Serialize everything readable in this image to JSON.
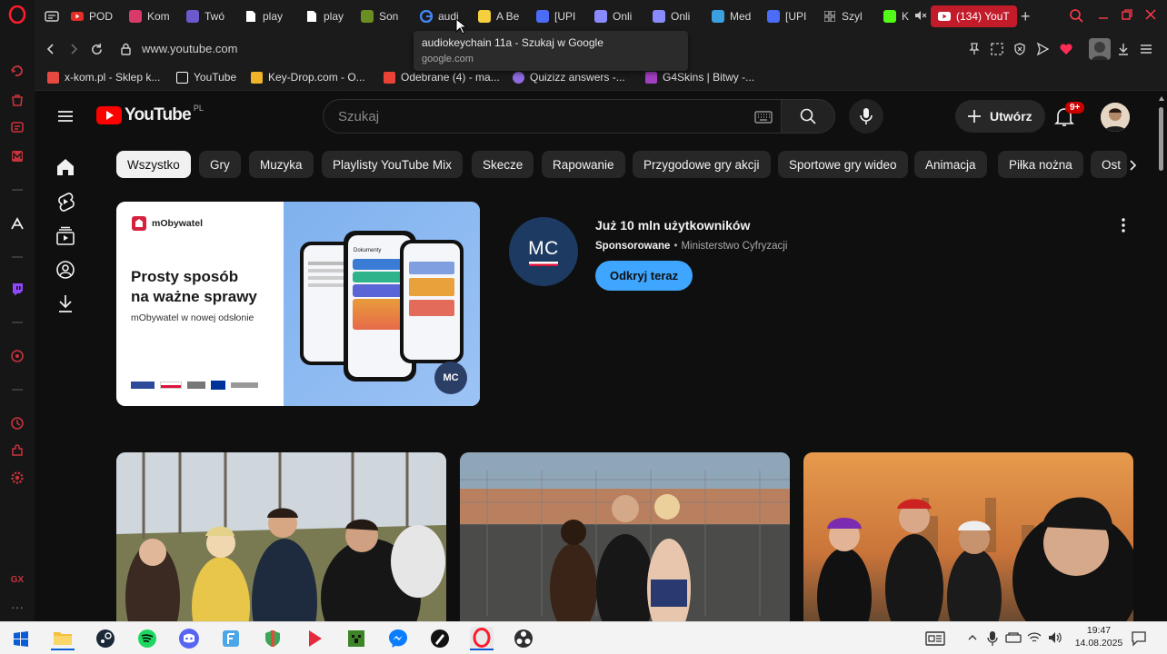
{
  "browser": {
    "tabs": [
      {
        "label": "POD",
        "icon": "youtube-icon",
        "color": "#e52d27"
      },
      {
        "label": "Kom",
        "icon": "generic-icon",
        "color": "#d83b6a"
      },
      {
        "label": "Twó",
        "icon": "generic-icon",
        "color": "#6a5acd"
      },
      {
        "label": "play",
        "icon": "document-icon",
        "color": "#ffffff"
      },
      {
        "label": "play",
        "icon": "document-icon",
        "color": "#ffffff"
      },
      {
        "label": "Son",
        "icon": "generic-icon",
        "color": "#6b8e23"
      },
      {
        "label": "audi",
        "icon": "google-icon",
        "color": "#4285f4"
      },
      {
        "label": "A Be",
        "icon": "generic-icon",
        "color": "#f4d03f"
      },
      {
        "label": "[UPI",
        "icon": "generic-icon",
        "color": "#4a6cf7"
      },
      {
        "label": "Onli",
        "icon": "generic-icon",
        "color": "#8a8aff"
      },
      {
        "label": "Onli",
        "icon": "generic-icon",
        "color": "#8a8aff"
      },
      {
        "label": "Med",
        "icon": "generic-icon",
        "color": "#3aa0e0"
      },
      {
        "label": "[UPI",
        "icon": "generic-icon",
        "color": "#4a6cf7"
      },
      {
        "label": "Szyl",
        "icon": "grid-icon",
        "color": "#cccccc"
      },
      {
        "label": "K",
        "icon": "generic-icon",
        "color": "#53fc18"
      },
      {
        "label": "(134) YouT",
        "icon": "youtube-icon",
        "color": "#ffffff"
      }
    ],
    "url": "www.youtube.com",
    "tooltip": {
      "title": "audiokeychain 11a - Szukaj w Google",
      "domain": "google.com"
    },
    "bookmarks": [
      {
        "label": "x-kom.pl - Sklep k...",
        "color": "#e8483f"
      },
      {
        "label": "YouTube",
        "color": "#ffffff"
      },
      {
        "label": "Key-Drop.com - O...",
        "color": "#f0b429"
      },
      {
        "label": "Odebrane (4) - ma...",
        "color": "#ea4335"
      },
      {
        "label": "Quizizz answers -...",
        "color": "#8e6be0"
      },
      {
        "label": "G4Skins | Bitwy -...",
        "color": "#a040c0"
      }
    ]
  },
  "youtube": {
    "logo_text": "YouTube",
    "region": "PL",
    "search_placeholder": "Szukaj",
    "create_label": "Utwórz",
    "notification_count": "9+",
    "chips": [
      "Wszystko",
      "Gry",
      "Muzyka",
      "Playlisty YouTube Mix",
      "Skecze",
      "Rapowanie",
      "Przygodowe gry akcji",
      "Sportowe gry wideo",
      "Animacja",
      "Piłka nożna",
      "Ost"
    ],
    "ad": {
      "brand": "mObywatel",
      "headline_line1": "Prosty sposób",
      "headline_line2": "na ważne sprawy",
      "subline": "mObywatel w nowej odsłonie",
      "phone_title": "Dokumenty",
      "badge": "MC",
      "avatar_text": "MC",
      "title": "Już 10 mln użytkowników",
      "sponsored": "Sponsorowane",
      "separator": "•",
      "advertiser": "Ministerstwo Cyfryzacji",
      "cta": "Odkryj teraz"
    }
  },
  "taskbar": {
    "time": "19:47",
    "date": "14.08.2025"
  }
}
